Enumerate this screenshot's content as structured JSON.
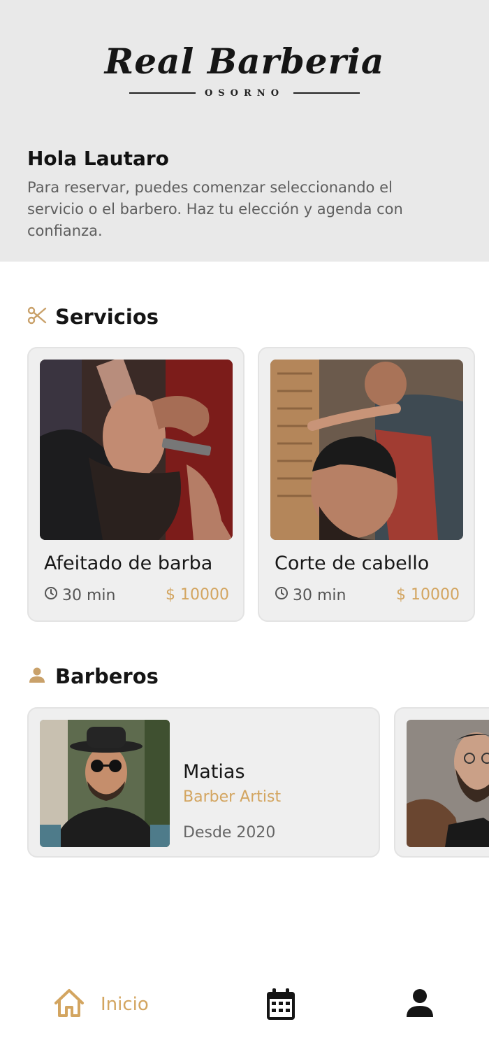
{
  "header": {
    "logo_title": "Real Barberia",
    "logo_subtitle": "OSORNO",
    "greeting": "Hola Lautaro",
    "intro": "Para reservar, puedes comenzar seleccionando el servicio o el barbero. Haz tu elección y agenda con confianza."
  },
  "services": {
    "title": "Servicios",
    "icon": "scissors-icon",
    "items": [
      {
        "name": "Afeitado de barba",
        "duration": "30 min",
        "price": "$ 10000"
      },
      {
        "name": "Corte de cabello",
        "duration": "30 min",
        "price": "$ 10000"
      }
    ]
  },
  "barbers": {
    "title": "Barberos",
    "icon": "person-icon",
    "items": [
      {
        "name": "Matias",
        "role": "Barber Artist",
        "since": "Desde 2020"
      }
    ]
  },
  "nav": {
    "home_label": "Inicio",
    "items": [
      "home-icon",
      "calendar-icon",
      "profile-icon"
    ]
  },
  "colors": {
    "accent": "#d3a560",
    "header_bg": "#e9e9e9",
    "card_bg": "#efefef"
  }
}
